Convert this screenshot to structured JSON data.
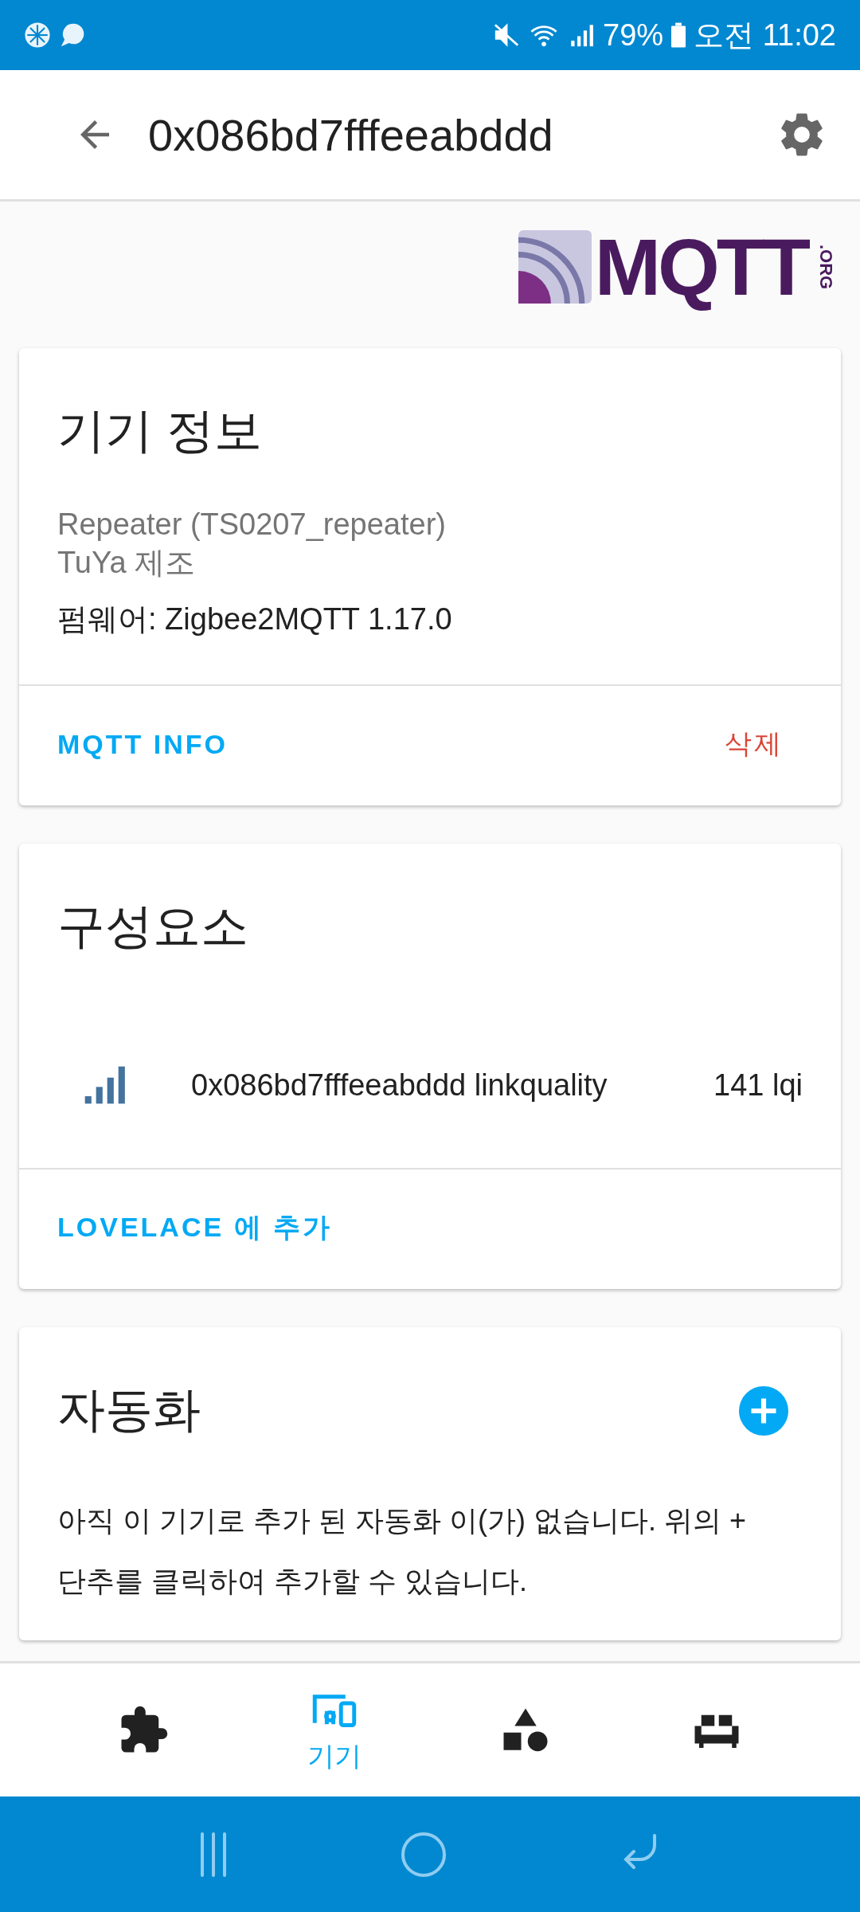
{
  "status_bar": {
    "battery": "79%",
    "time": "오전 11:02"
  },
  "app_bar": {
    "title": "0x086bd7fffeeabddd"
  },
  "logo": {
    "text": "MQTT",
    "suffix": ".ORG"
  },
  "device_info": {
    "title": "기기 정보",
    "model": "Repeater (TS0207_repeater)",
    "manufacturer": "TuYa 제조",
    "firmware": "펌웨어: Zigbee2MQTT 1.17.0",
    "actions": [
      {
        "label": "MQTT INFO",
        "kind": "primary"
      },
      {
        "label": "삭제",
        "kind": "danger"
      }
    ]
  },
  "entities": {
    "title": "구성요소",
    "items": [
      {
        "name": "0x086bd7fffeeabddd linkquality",
        "state": "141 lqi"
      }
    ],
    "action": "LOVELACE 에 추가"
  },
  "automations": {
    "title": "자동화",
    "empty_text": "아직 이 기기로 추가 된 자동화 이(가) 없습니다. 위의 + 단추를 클릭하여 추가할 수 있습니다."
  },
  "bottom_nav": [
    {
      "kind": "integrations",
      "selected": false
    },
    {
      "kind": "devices",
      "label": "기기",
      "selected": true
    },
    {
      "kind": "entities",
      "selected": false
    },
    {
      "kind": "areas",
      "selected": false
    }
  ]
}
